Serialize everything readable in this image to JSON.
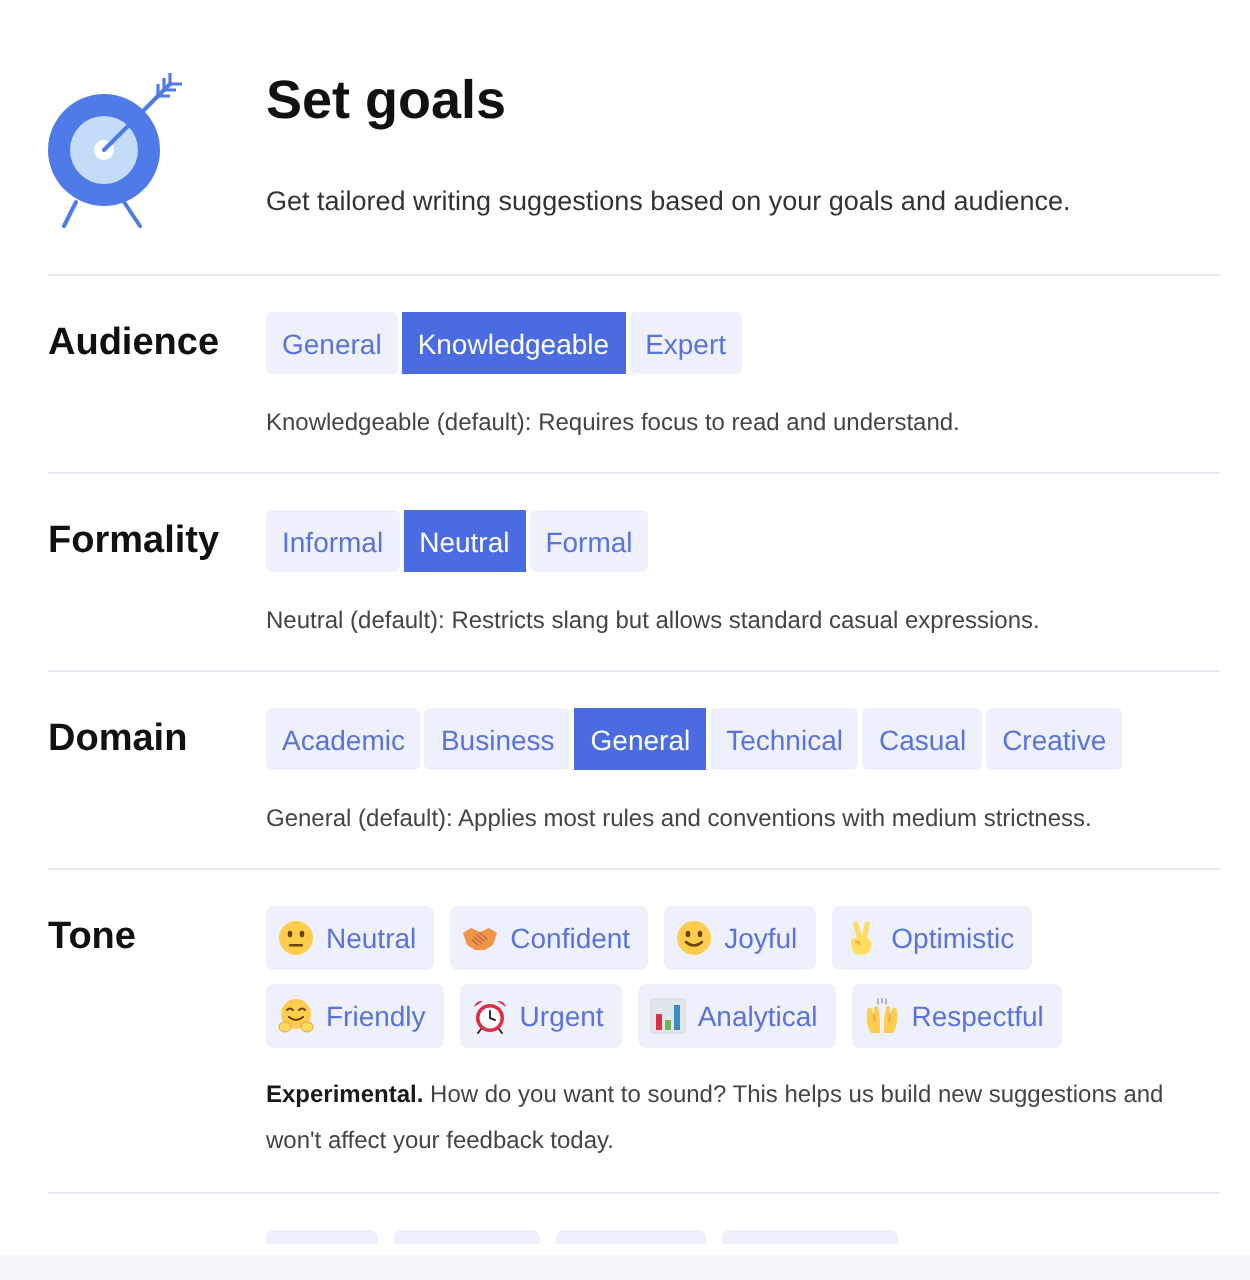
{
  "header": {
    "title": "Set goals",
    "subtitle": "Get tailored writing suggestions based on your goals and audience."
  },
  "sections": [
    {
      "label": "Audience",
      "kind": "segmented",
      "options": [
        {
          "label": "General",
          "selected": false
        },
        {
          "label": "Knowledgeable",
          "selected": true
        },
        {
          "label": "Expert",
          "selected": false
        }
      ],
      "description": "Knowledgeable (default): Requires focus to read and understand."
    },
    {
      "label": "Formality",
      "kind": "segmented",
      "options": [
        {
          "label": "Informal",
          "selected": false
        },
        {
          "label": "Neutral",
          "selected": true
        },
        {
          "label": "Formal",
          "selected": false
        }
      ],
      "description": "Neutral (default): Restricts slang but allows standard casual expressions."
    },
    {
      "label": "Domain",
      "kind": "segmented",
      "options": [
        {
          "label": "Academic",
          "selected": false
        },
        {
          "label": "Business",
          "selected": false
        },
        {
          "label": "General",
          "selected": true
        },
        {
          "label": "Technical",
          "selected": false
        },
        {
          "label": "Casual",
          "selected": false
        },
        {
          "label": "Creative",
          "selected": false
        }
      ],
      "description": "General (default): Applies most rules and conventions with medium strictness."
    },
    {
      "label": "Tone",
      "kind": "chips",
      "options": [
        {
          "label": "Neutral",
          "selected": false
        },
        {
          "label": "Confident",
          "selected": false
        },
        {
          "label": "Joyful",
          "selected": false
        },
        {
          "label": "Optimistic",
          "selected": false
        },
        {
          "label": "Friendly",
          "selected": false
        },
        {
          "label": "Urgent",
          "selected": false
        },
        {
          "label": "Analytical",
          "selected": false
        },
        {
          "label": "Respectful",
          "selected": false
        }
      ],
      "description": "**Experimental.** How do you want to sound? This helps us build new suggestions and won't affect your feedback today."
    }
  ]
}
